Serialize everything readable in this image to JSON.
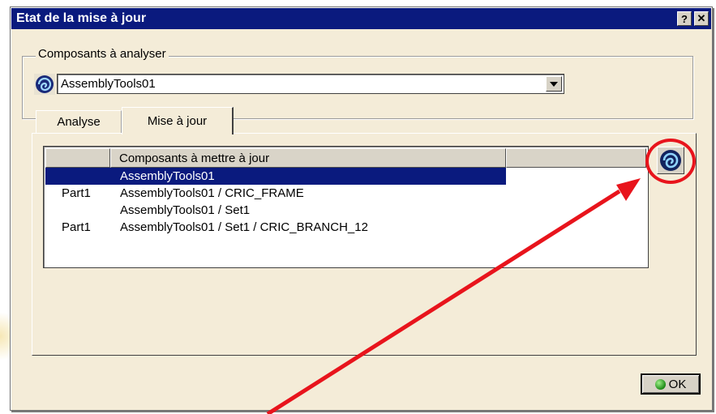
{
  "window": {
    "title": "Etat de la mise à jour",
    "help_label": "?",
    "close_label": "✕"
  },
  "components_group": {
    "legend": "Composants à analyser",
    "selected": "AssemblyTools01"
  },
  "tabs": [
    {
      "label": "Analyse",
      "active": false
    },
    {
      "label": "Mise à jour",
      "active": true
    }
  ],
  "list": {
    "columns": [
      "",
      "Composants à mettre à jour",
      ""
    ],
    "rows": [
      {
        "type": "",
        "component": "AssemblyTools01",
        "selected": true
      },
      {
        "type": "Part1",
        "component": "AssemblyTools01 / CRIC_FRAME",
        "selected": false
      },
      {
        "type": "",
        "component": "AssemblyTools01 / Set1",
        "selected": false
      },
      {
        "type": "Part1",
        "component": "AssemblyTools01 / Set1 / CRIC_BRANCH_12",
        "selected": false
      }
    ]
  },
  "footer": {
    "ok_label": "OK"
  },
  "colors": {
    "titlebar": "#0a1a7e",
    "dialog_bg": "#f4ecd8",
    "annotation": "#e8141c"
  },
  "icons": {
    "component": "update-swirl-icon",
    "update_button": "update-swirl-icon",
    "ok": "green-dot-icon"
  }
}
